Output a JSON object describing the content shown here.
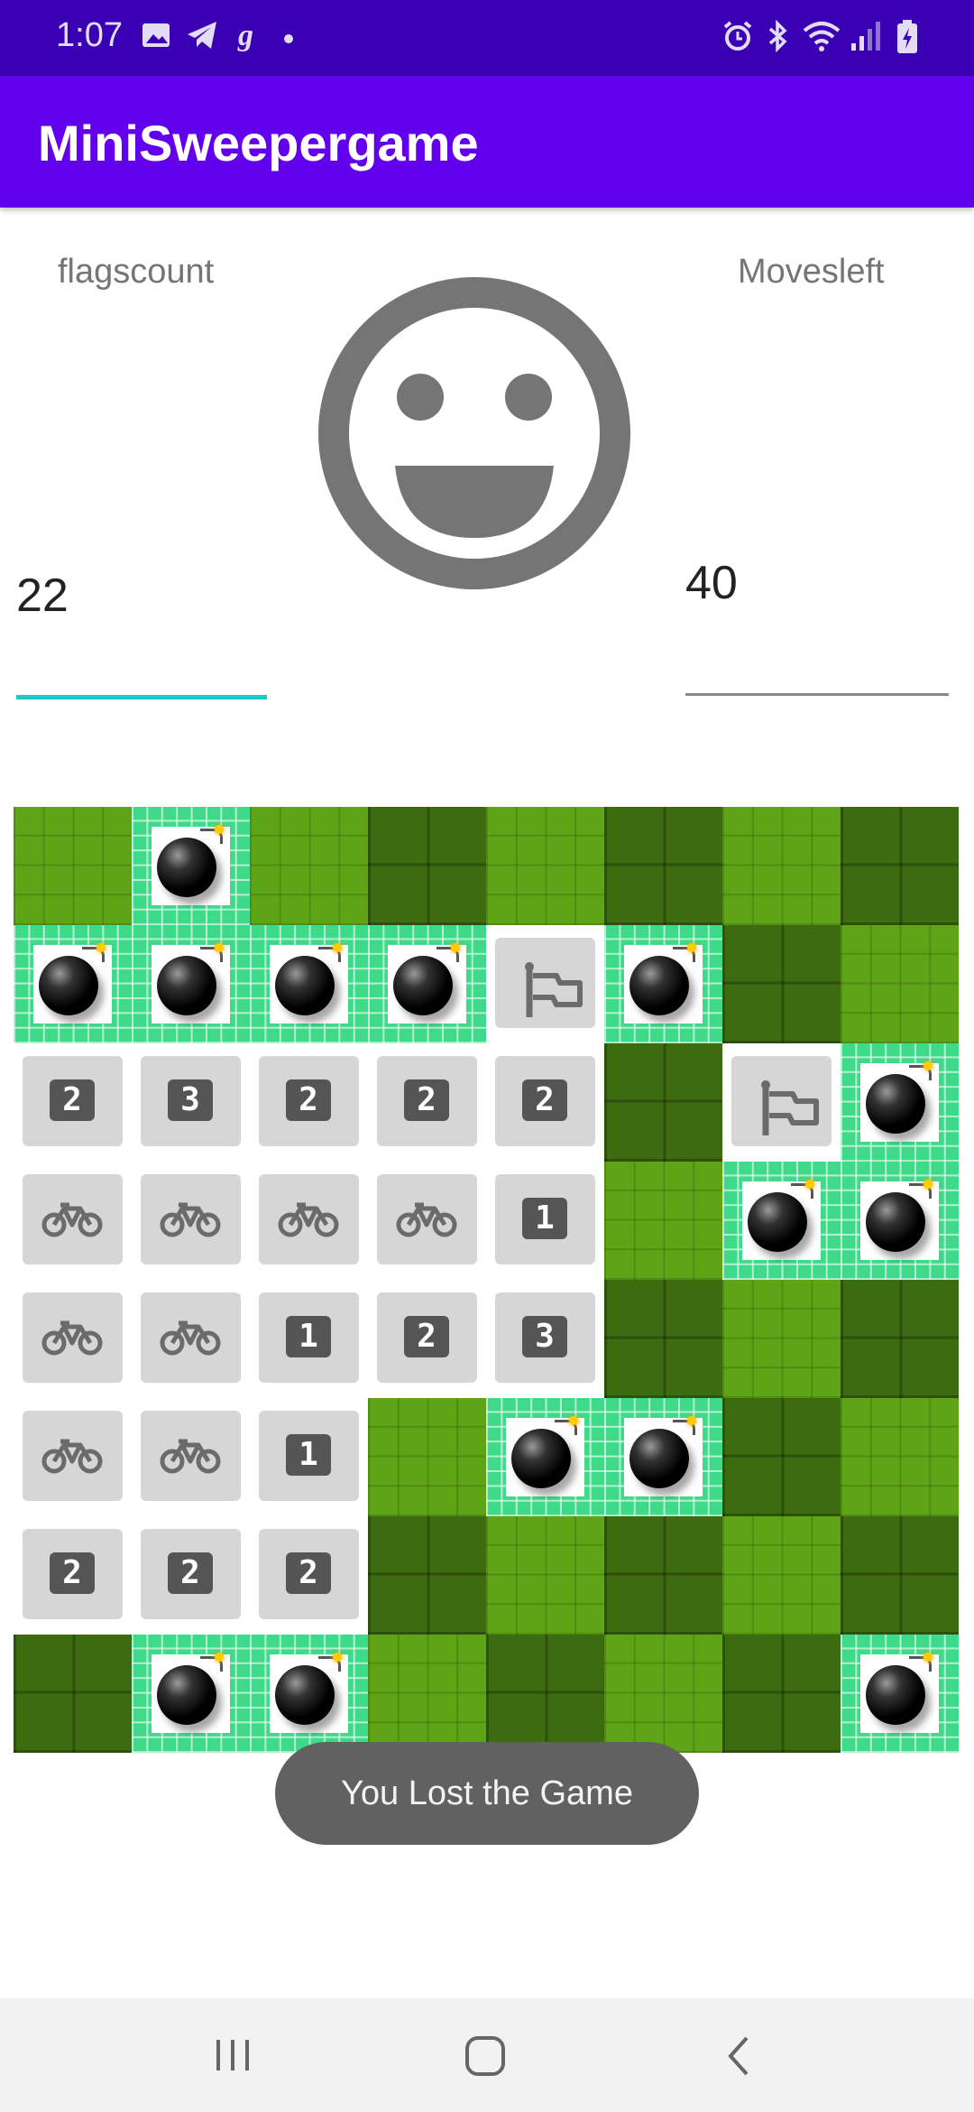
{
  "status_bar": {
    "time": "1:07",
    "icons": [
      "image-icon",
      "telegram-icon",
      "g-icon",
      "dot-icon",
      "alarm-icon",
      "bluetooth-icon",
      "wifi-icon",
      "signal-icon",
      "battery-charging-icon"
    ]
  },
  "app_bar": {
    "title": "MiniSweepergame"
  },
  "header": {
    "flags_label": "flagscount",
    "flags_value": "22",
    "moves_label": "Movesleft",
    "moves_value": "40",
    "status_face": "smiley-icon"
  },
  "board": {
    "rows": 8,
    "cols": 8,
    "grid": [
      [
        "G",
        "M",
        "G",
        "D",
        "G",
        "D",
        "G",
        "D"
      ],
      [
        "M",
        "M",
        "M",
        "M",
        "F",
        "M",
        "D",
        "G"
      ],
      [
        "2",
        "3",
        "2",
        "2",
        "2",
        "D",
        "F",
        "M"
      ],
      [
        "B",
        "B",
        "B",
        "B",
        "1",
        "G",
        "M",
        "M"
      ],
      [
        "B",
        "B",
        "1",
        "2",
        "3",
        "D",
        "G",
        "D"
      ],
      [
        "B",
        "B",
        "1",
        "G",
        "M",
        "M",
        "D",
        "G"
      ],
      [
        "2",
        "2",
        "2",
        "D",
        "G",
        "D",
        "G",
        "D"
      ],
      [
        "D",
        "M",
        "M",
        "G",
        "D",
        "G",
        "D",
        "M"
      ]
    ],
    "legend": {
      "G": "unrevealed-grass",
      "D": "unrevealed-grass-dark",
      "M": "mine",
      "F": "flag",
      "B": "empty-bike",
      "1": "number",
      "2": "number",
      "3": "number"
    }
  },
  "toast": {
    "message": "You Lost the Game"
  },
  "nav_bar": {
    "buttons": [
      "recent-apps-icon",
      "home-icon",
      "back-icon"
    ]
  },
  "colors": {
    "status_bar": "#3a00b3",
    "app_bar": "#6200ee",
    "accent": "#1ec8c8",
    "mine_bg": "#3fd98a",
    "toast_bg": "#616161"
  }
}
